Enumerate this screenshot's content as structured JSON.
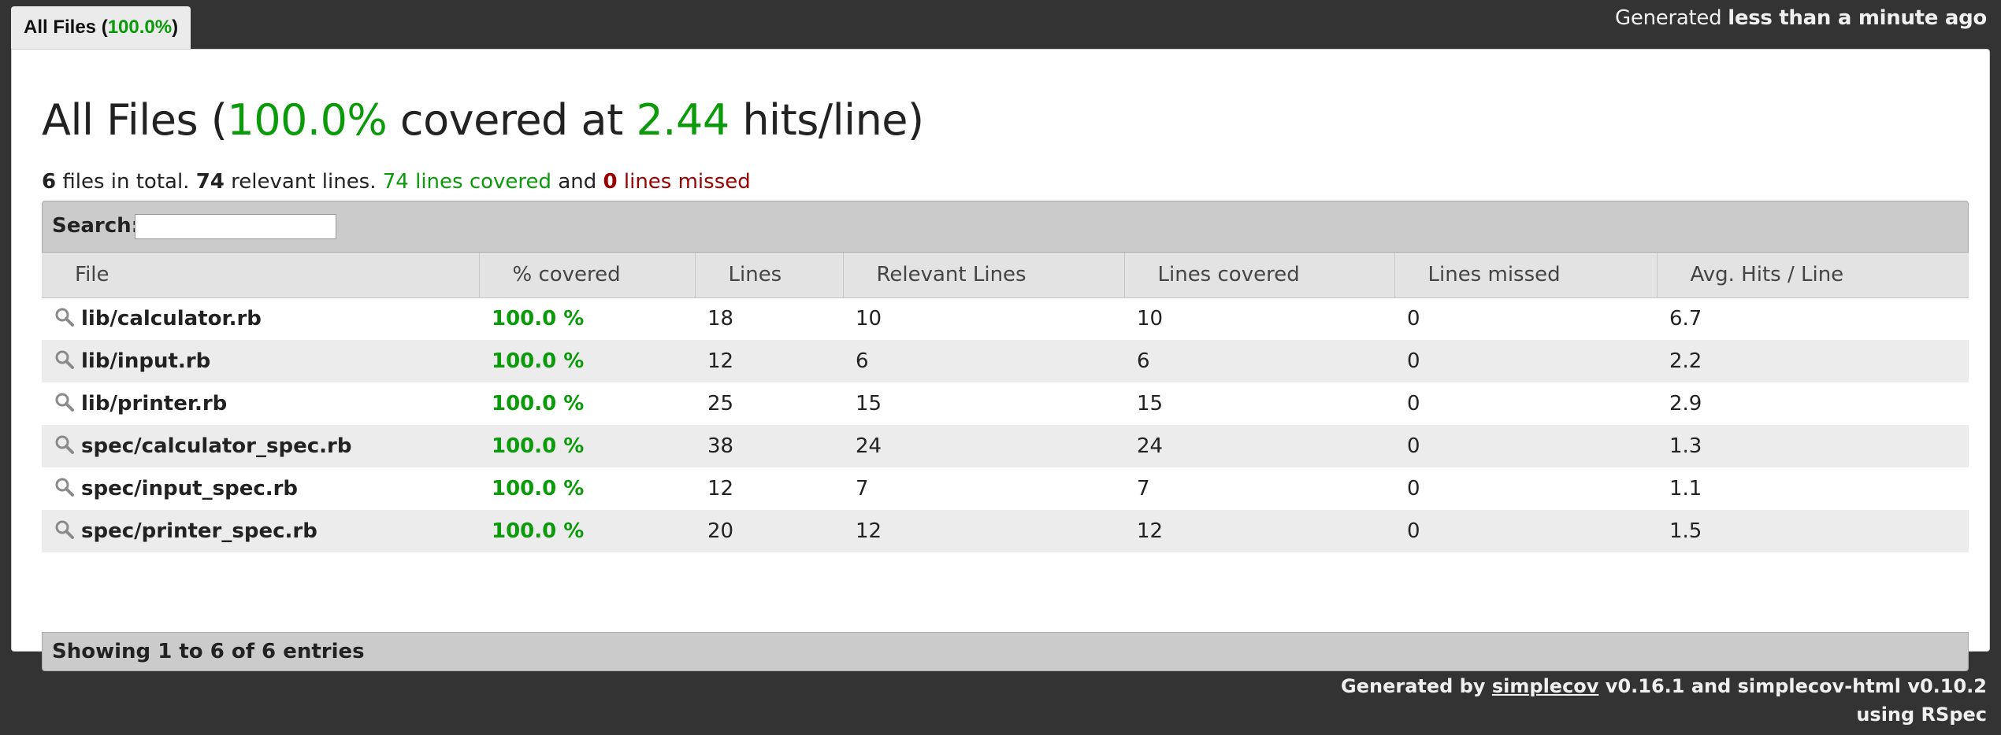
{
  "tab": {
    "label": "All Files",
    "open_paren": " (",
    "percent": "100.0%",
    "close_paren": ")"
  },
  "header": {
    "generated_prefix": "Generated ",
    "generated_time": "less than a minute ago"
  },
  "title": {
    "prefix": "All Files (",
    "percent": "100.0%",
    "middle": " covered at ",
    "hits": "2.44",
    "suffix": " hits/line)"
  },
  "summary": {
    "file_count": "6",
    "files_text": " files in total. ",
    "relevant_count": "74",
    "relevant_text": " relevant lines. ",
    "covered": "74 lines covered",
    "and_text": " and ",
    "missed_count": "0",
    "missed_text": " lines missed"
  },
  "search": {
    "label": "Search:",
    "value": ""
  },
  "table": {
    "columns": [
      "File",
      "% covered",
      "Lines",
      "Relevant Lines",
      "Lines covered",
      "Lines missed",
      "Avg. Hits / Line"
    ],
    "rows": [
      {
        "file": "lib/calculator.rb",
        "covered": "100.0 %",
        "lines": "18",
        "relevant": "10",
        "lines_covered": "10",
        "missed": "0",
        "avg": "6.7"
      },
      {
        "file": "lib/input.rb",
        "covered": "100.0 %",
        "lines": "12",
        "relevant": "6",
        "lines_covered": "6",
        "missed": "0",
        "avg": "2.2"
      },
      {
        "file": "lib/printer.rb",
        "covered": "100.0 %",
        "lines": "25",
        "relevant": "15",
        "lines_covered": "15",
        "missed": "0",
        "avg": "2.9"
      },
      {
        "file": "spec/calculator_spec.rb",
        "covered": "100.0 %",
        "lines": "38",
        "relevant": "24",
        "lines_covered": "24",
        "missed": "0",
        "avg": "1.3"
      },
      {
        "file": "spec/input_spec.rb",
        "covered": "100.0 %",
        "lines": "12",
        "relevant": "7",
        "lines_covered": "7",
        "missed": "0",
        "avg": "1.1"
      },
      {
        "file": "spec/printer_spec.rb",
        "covered": "100.0 %",
        "lines": "20",
        "relevant": "12",
        "lines_covered": "12",
        "missed": "0",
        "avg": "1.5"
      }
    ],
    "row_icon": "magnifier-icon"
  },
  "info": {
    "text": "Showing 1 to 6 of 6 entries"
  },
  "footer": {
    "prefix": "Generated by ",
    "link": "simplecov",
    "middle": " v0.16.1 and simplecov-html v0.10.2",
    "line2": "using RSpec"
  },
  "colors": {
    "covered_green": "#0a9a0a",
    "missed_red": "#990000",
    "background_dark": "#333333"
  }
}
